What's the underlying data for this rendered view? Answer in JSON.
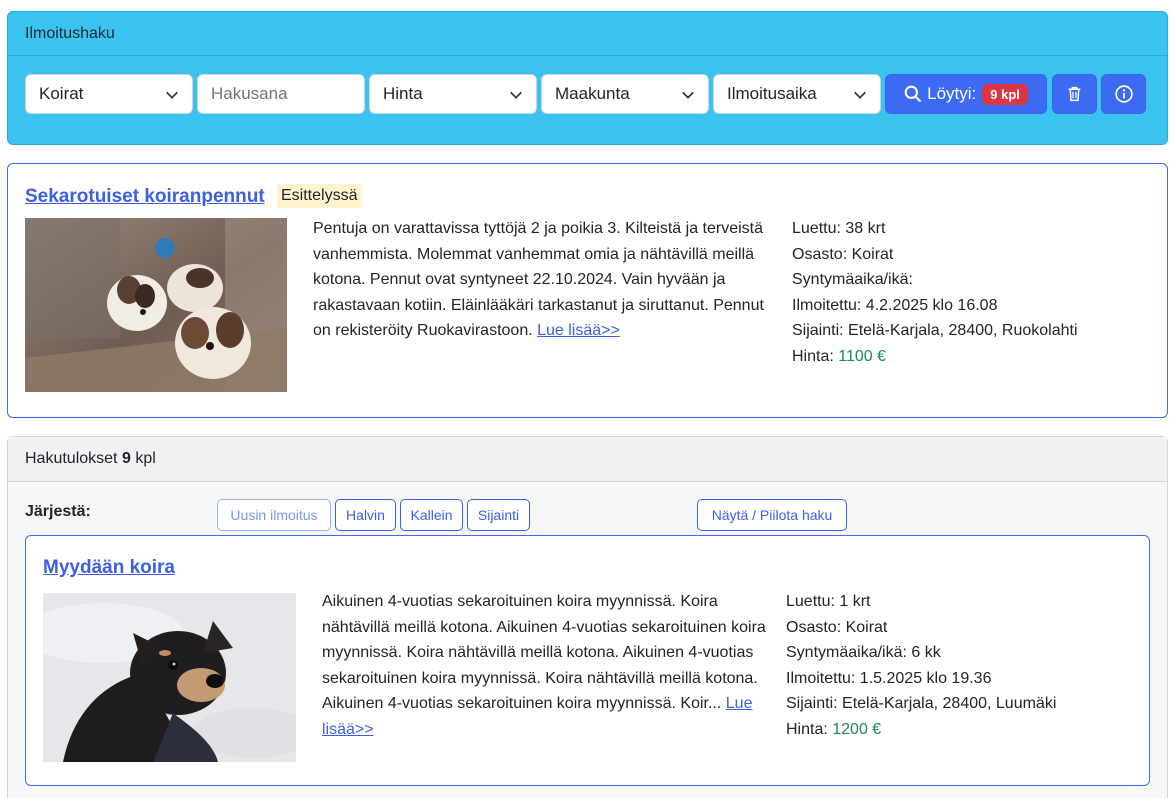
{
  "search": {
    "header": "Ilmoitushaku",
    "category": "Koirat",
    "keyword_placeholder": "Hakusana",
    "price": "Hinta",
    "region": "Maakunta",
    "date": "Ilmoitusaika",
    "found_label": "Löytyi:",
    "found_count": "9 kpl"
  },
  "featured": {
    "title": "Sekarotuiset koiranpennut",
    "tag": "Esittelyssä",
    "description": "Pentuja on varattavissa tyttöjä 2 ja poikia 3. Kilteistä ja terveistä vanhemmista. Molemmat vanhemmat omia ja nähtävillä meillä kotona. Pennut ovat syntyneet 22.10.2024. Vain hyvään ja rakastavaan kotiin. Eläinlääkäri tarkastanut ja siruttanut. Pennut on rekisteröity Ruokavirastoon.",
    "read_more": "Lue lisää>>",
    "meta": {
      "read": "Luettu: 38 krt",
      "section": "Osasto: Koirat",
      "birth": "Syntymäaika/ikä:",
      "posted": "Ilmoitettu: 4.2.2025 klo 16.08",
      "location": "Sijainti: Etelä-Karjala, 28400, Ruokolahti",
      "price_label": "Hinta:",
      "price": "1100 €"
    }
  },
  "results": {
    "label": "Hakutulokset",
    "count": "9",
    "unit": "kpl",
    "sort_label": "Järjestä:",
    "sort_buttons": [
      "Uusin ilmoitus",
      "Halvin",
      "Kallein",
      "Sijainti"
    ],
    "toggle_search": "Näytä / Piilota haku"
  },
  "listing": {
    "title": "Myydään koira",
    "description": "Aikuinen 4-vuotias sekaroituinen koira myynnissä. Koira nähtävillä meillä kotona. Aikuinen 4-vuotias sekaroituinen koira myynnissä. Koira nähtävillä meillä kotona. Aikuinen 4-vuotias sekaroituinen koira myynnissä. Koira nähtävillä meillä kotona. Aikuinen 4-vuotias sekaroituinen koira myynnissä. Koir...",
    "read_more": "Lue lisää>>",
    "meta": {
      "read": "Luettu: 1 krt",
      "section": "Osasto: Koirat",
      "birth": "Syntymäaika/ikä: 6 kk",
      "posted": "Ilmoitettu: 1.5.2025 klo 19.36",
      "location": "Sijainti: Etelä-Karjala, 28400, Luumäki",
      "price_label": "Hinta:",
      "price": "1200 €"
    }
  },
  "colors": {
    "panel": "#39c3ee",
    "primary": "#3d6af2",
    "badge": "#dc3545",
    "price": "#1c8a52",
    "tag": "#fff3cd"
  },
  "icons": [
    "chevron-down-icon",
    "search-icon",
    "trash-icon",
    "info-icon"
  ]
}
